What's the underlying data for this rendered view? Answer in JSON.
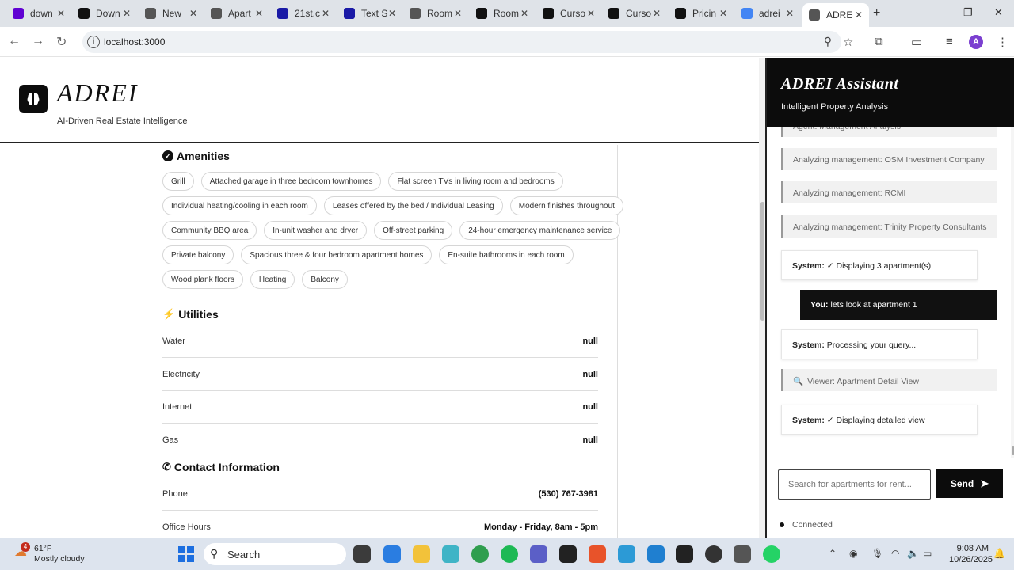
{
  "browser": {
    "tabs": [
      {
        "label": "down",
        "favicon": "yahoo-icon",
        "color": "#6001d2"
      },
      {
        "label": "Down",
        "favicon": "notion-icon",
        "color": "#111111"
      },
      {
        "label": "New",
        "favicon": "globe-icon",
        "color": "#555555"
      },
      {
        "label": "Apart",
        "favicon": "globe-icon",
        "color": "#555555"
      },
      {
        "label": "21st.c",
        "favicon": "bracket-icon",
        "color": "#1a1aa6"
      },
      {
        "label": "Text S",
        "favicon": "bracket-icon",
        "color": "#1a1aa6"
      },
      {
        "label": "Room",
        "favicon": "globe-icon",
        "color": "#555555"
      },
      {
        "label": "Room",
        "favicon": "github-icon",
        "color": "#111111"
      },
      {
        "label": "Curso",
        "favicon": "cursor-icon",
        "color": "#111111"
      },
      {
        "label": "Curso",
        "favicon": "cursor-icon",
        "color": "#111111"
      },
      {
        "label": "Pricin",
        "favicon": "cursor-icon",
        "color": "#111111"
      },
      {
        "label": "adrei",
        "favicon": "google-icon",
        "color": "#4285f4"
      },
      {
        "label": "ADRE",
        "favicon": "globe-icon",
        "color": "#555555",
        "active": true
      }
    ],
    "url": "localhost:3000",
    "profile_initial": "A"
  },
  "app": {
    "brand": "ADREI",
    "tagline": "AI-Driven Real Estate Intelligence"
  },
  "amenities": {
    "heading": "Amenities",
    "rows": [
      [
        "Grill",
        "Attached garage in three bedroom townhomes",
        "Flat screen TVs in living room and bedrooms"
      ],
      [
        "Individual heating/cooling in each room",
        "Leases offered by the bed / Individual Leasing",
        "Modern finishes throughout"
      ],
      [
        "Community BBQ area",
        "In-unit washer and dryer",
        "Off-street parking",
        "24-hour emergency maintenance service"
      ],
      [
        "Private balcony",
        "Spacious three & four bedroom apartment homes",
        "En-suite bathrooms in each room"
      ],
      [
        "Wood plank floors",
        "Heating",
        "Balcony"
      ]
    ]
  },
  "utilities": {
    "heading": "Utilities",
    "rows": [
      {
        "label": "Water",
        "value": "null"
      },
      {
        "label": "Electricity",
        "value": "null"
      },
      {
        "label": "Internet",
        "value": "null"
      },
      {
        "label": "Gas",
        "value": "null"
      }
    ]
  },
  "contact": {
    "heading": "Contact Information",
    "rows": [
      {
        "label": "Phone",
        "value": "(530) 767-3981"
      },
      {
        "label": "Office Hours",
        "value": "Monday - Friday, 8am - 5pm"
      }
    ]
  },
  "assistant": {
    "title": "ADREI Assistant",
    "subtitle": "Intelligent Property Analysis",
    "messages": [
      {
        "type": "agent",
        "text": "Agent: Management Analysis"
      },
      {
        "type": "agent",
        "text": "Analyzing management: OSM Investment Company"
      },
      {
        "type": "agent",
        "text": "Analyzing management: RCMI"
      },
      {
        "type": "agent",
        "text": "Analyzing management: Trinity Property Consultants"
      },
      {
        "type": "system",
        "speaker": "System:",
        "text": "✓ Displaying 3 apartment(s)"
      },
      {
        "type": "user",
        "speaker": "You:",
        "text": "lets look at apartment 1"
      },
      {
        "type": "system",
        "speaker": "System:",
        "text": "Processing your query..."
      },
      {
        "type": "agent",
        "text": "Viewer: Apartment Detail View"
      },
      {
        "type": "system",
        "speaker": "System:",
        "text": "✓ Displaying detailed view"
      }
    ],
    "input_placeholder": "Search for apartments for rent...",
    "send_label": "Send",
    "status": "Connected"
  },
  "taskbar": {
    "weather_temp": "61°F",
    "weather_desc": "Mostly cloudy",
    "weather_badge": "4",
    "search_label": "Search",
    "time": "9:08 AM",
    "date": "10/26/2025"
  }
}
